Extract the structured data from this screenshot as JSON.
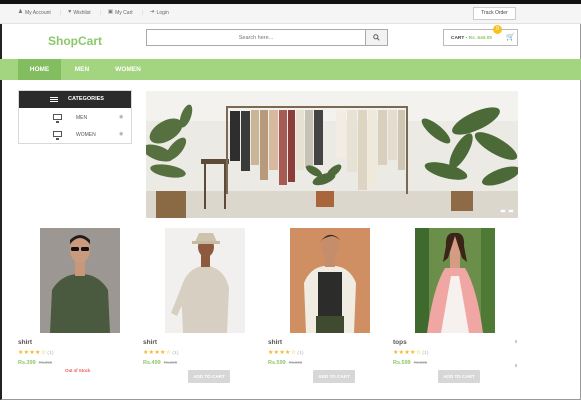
{
  "topbar": {
    "links": [
      {
        "icon": "user-icon",
        "label": "My Account"
      },
      {
        "icon": "heart-icon",
        "label": "Wishlist"
      },
      {
        "icon": "cart-icon",
        "label": "My Cart"
      },
      {
        "icon": "login-icon",
        "label": "Login"
      }
    ],
    "track_order": "Track Order"
  },
  "header": {
    "logo": "ShopCart",
    "search_placeholder": "Search here...",
    "cart_label": "CART -",
    "cart_amount": "Rs. 640.00",
    "cart_badge": "0"
  },
  "nav": {
    "items": [
      "HOME",
      "MEN",
      "WOMEN"
    ],
    "active": "HOME"
  },
  "categories": {
    "title": "CATEGORIES",
    "items": [
      "MEN",
      "WOMEN"
    ]
  },
  "colors": {
    "brand": "#8cc86b",
    "nav": "#a3d47f",
    "nav_active": "#82bd5f",
    "rating": "#f3b822",
    "out_of_stock": "#e02020"
  },
  "products": [
    {
      "name": "shirt",
      "rating": 4,
      "reviews": "(1)",
      "price": "Rs.399",
      "old_price": "Rs.599",
      "status": "Out of Stock",
      "button": ""
    },
    {
      "name": "shirt",
      "rating": 4,
      "reviews": "(1)",
      "price": "Rs.499",
      "old_price": "Rs.699",
      "status": "",
      "button": "ADD TO CART"
    },
    {
      "name": "shirt",
      "rating": 4,
      "reviews": "(1)",
      "price": "Rs.599",
      "old_price": "Rs.899",
      "status": "",
      "button": "ADD TO CART"
    },
    {
      "name": "tops",
      "rating": 4,
      "reviews": "(1)",
      "price": "Rs.599",
      "old_price": "Rs.699",
      "status": "",
      "button": "ADD TO CART"
    }
  ]
}
